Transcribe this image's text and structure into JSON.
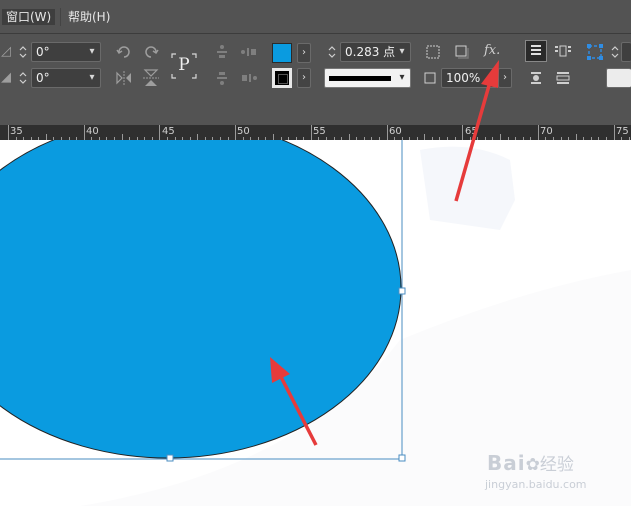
{
  "menubar": {
    "items": [
      {
        "label": "窗口(W)",
        "active": true
      },
      {
        "label": "帮助(H)",
        "active": false
      }
    ]
  },
  "toolbar": {
    "shear_angle": "0°",
    "rotate_angle": "0°",
    "proxy_label": "P",
    "stroke_weight": "0.283 点",
    "opacity": "100%",
    "fx_label": "fx.",
    "colors": {
      "fill": "#0a9be0",
      "stroke": "#000000",
      "panel": "#535353",
      "field": "#3f3f3f"
    }
  },
  "ruler": {
    "labels": [
      "35",
      "40",
      "45",
      "50",
      "55",
      "60",
      "65",
      "70",
      "75"
    ]
  },
  "canvas": {
    "shape": "ellipse",
    "fill_color": "#0a9be0",
    "stroke_color": "#222222",
    "frame_color": "#4a8cc2",
    "annotation_color": "#e63b3b"
  },
  "watermark": {
    "brand": "Bai",
    "brand_suffix": "经验",
    "url": "jingyan.baidu.com"
  }
}
